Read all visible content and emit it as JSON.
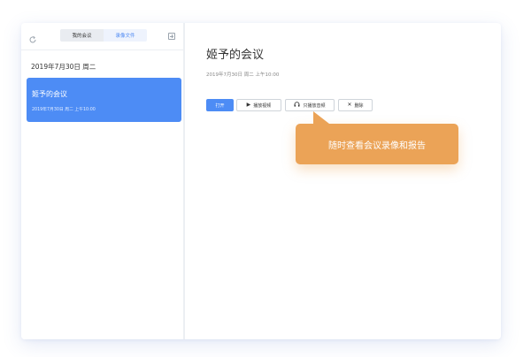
{
  "sidebar": {
    "tabs": [
      {
        "label": "我的会议"
      },
      {
        "label": "录像文件"
      }
    ],
    "date_group": "2019年7月30日 周二",
    "meetings": [
      {
        "title": "姬予的会议",
        "subtitle": "2019年7月30日 周二 上午10:00"
      }
    ]
  },
  "main": {
    "title": "姬予的会议",
    "subtitle": "2019年7月30日 周二 上午10:00",
    "buttons": {
      "open": "打开",
      "play_video": "播放视频",
      "audio_only": "只播放音频",
      "delete": "删除"
    }
  },
  "tooltip": {
    "text": "随时查看会议录像和报告"
  },
  "colors": {
    "accent": "#4d8cf5",
    "tooltip": "#eba357"
  },
  "icons": [
    "refresh-icon",
    "add-icon",
    "play-icon",
    "headphones-icon",
    "close-icon"
  ]
}
